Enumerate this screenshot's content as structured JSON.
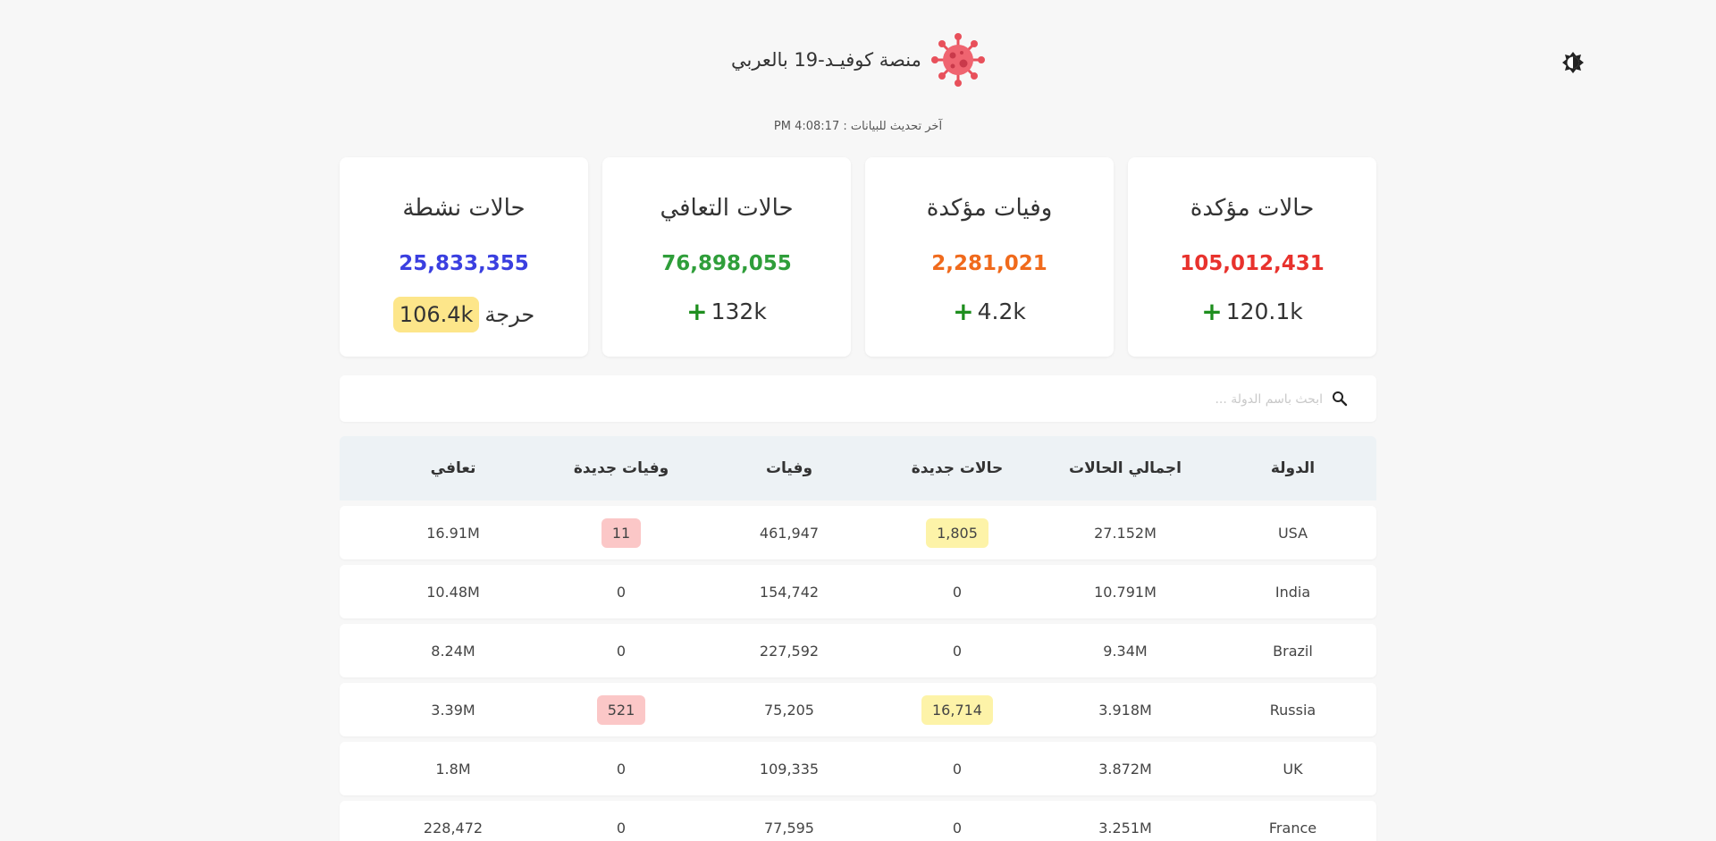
{
  "header": {
    "title": "منصة كوفيـد-19 بالعربي",
    "last_updated": "آخر تحديث للبيانات : PM 4:08:17"
  },
  "colors": {
    "confirmed": "#e8322d",
    "deaths": "#f06a1c",
    "recovered": "#2f9e3a",
    "active": "#3a3fe0",
    "plus": "#1e8e1e",
    "new_cases_badge": "#fdf3a8",
    "new_deaths_badge": "#fbc7c7"
  },
  "cards": {
    "confirmed": {
      "title": "حالات مؤكدة",
      "value": "105,012,431",
      "delta": "120.1k",
      "delta_icon": "plus-icon"
    },
    "deaths": {
      "title": "وفيات مؤكدة",
      "value": "2,281,021",
      "delta": "4.2k",
      "delta_icon": "plus-icon"
    },
    "recovered": {
      "title": "حالات التعافي",
      "value": "76,898,055",
      "delta": "132k",
      "delta_icon": "plus-icon"
    },
    "active": {
      "title": "حالات نشطة",
      "value": "25,833,355",
      "critical_label": "حرجة",
      "critical_value": "106.4k"
    }
  },
  "search": {
    "placeholder": "ابحث باسم الدولة ...",
    "value": "",
    "icon": "search-icon"
  },
  "table": {
    "headers": {
      "country": "الدولة",
      "total_cases": "اجمالي الحالات",
      "new_cases": "حالات جديدة",
      "deaths": "وفيات",
      "new_deaths": "وفيات جديدة",
      "recovered": "تعافي"
    },
    "rows": [
      {
        "country": "USA",
        "total_cases": "27.152M",
        "new_cases": "1,805",
        "deaths": "461,947",
        "new_deaths": "11",
        "recovered": "16.91M"
      },
      {
        "country": "India",
        "total_cases": "10.791M",
        "new_cases": "0",
        "deaths": "154,742",
        "new_deaths": "0",
        "recovered": "10.48M"
      },
      {
        "country": "Brazil",
        "total_cases": "9.34M",
        "new_cases": "0",
        "deaths": "227,592",
        "new_deaths": "0",
        "recovered": "8.24M"
      },
      {
        "country": "Russia",
        "total_cases": "3.918M",
        "new_cases": "16,714",
        "deaths": "75,205",
        "new_deaths": "521",
        "recovered": "3.39M"
      },
      {
        "country": "UK",
        "total_cases": "3.872M",
        "new_cases": "0",
        "deaths": "109,335",
        "new_deaths": "0",
        "recovered": "1.8M"
      },
      {
        "country": "France",
        "total_cases": "3.251M",
        "new_cases": "0",
        "deaths": "77,595",
        "new_deaths": "0",
        "recovered": "228,472"
      }
    ]
  }
}
